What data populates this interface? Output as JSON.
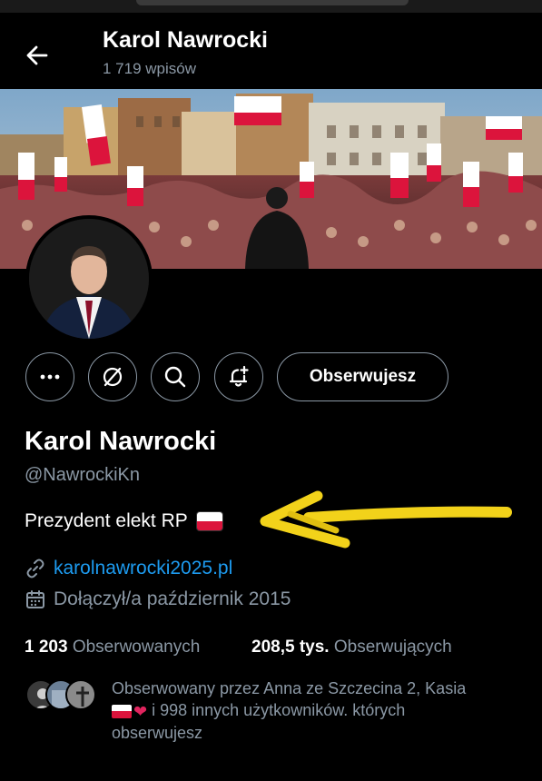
{
  "header": {
    "title": "Karol Nawrocki",
    "post_count": "1 719 wpisów"
  },
  "actions": {
    "more_icon": "ellipsis-icon",
    "grok_icon": "slashed-circle-icon",
    "search_icon": "search-icon",
    "notify_icon": "bell-plus-icon",
    "follow_label": "Obserwujesz"
  },
  "profile": {
    "name": "Karol Nawrocki",
    "handle": "@NawrockiKn",
    "bio": "Prezydent elekt RP",
    "link": "karolnawrocki2025.pl",
    "joined": "Dołączył/a październik 2015"
  },
  "stats": {
    "following_count": "1 203",
    "following_label": "Obserwowanych",
    "followers_count": "208,5 tys.",
    "followers_label": "Obserwujących"
  },
  "followed_by": {
    "line1": "Obserwowany przez Anna ze Szczecina 2, Kasia",
    "line2": "i 998 innych użytkowników. których",
    "line3": "obserwujesz"
  },
  "colors": {
    "background": "#000000",
    "text": "#e7e9ea",
    "muted": "#8b98a5",
    "link": "#1d9bf0",
    "annotation_arrow": "#f2d21a"
  }
}
